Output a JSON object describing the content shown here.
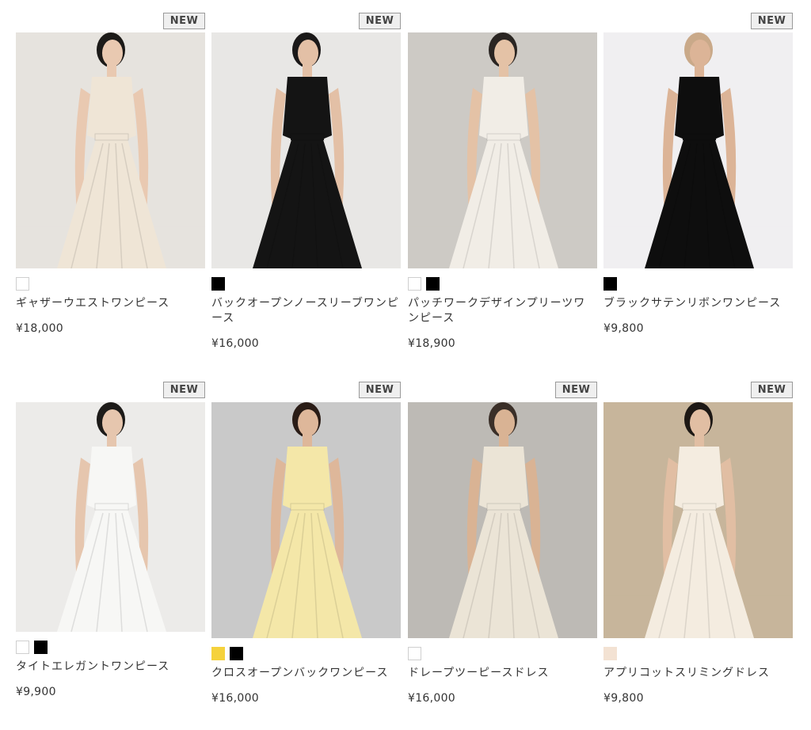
{
  "badge_label": "NEW",
  "products": [
    {
      "name": "ギャザーウエストワンピース",
      "price": "¥18,000",
      "new": true,
      "swatches": [
        "#ffffff"
      ],
      "icon": "pleated-dress-photo",
      "colors": {
        "bg": "#e6e3de",
        "garment": "#efe5d6",
        "skin": "#e9c9b1",
        "hair": "#1c1a18"
      }
    },
    {
      "name": "バックオープンノースリーブワンピース",
      "price": "¥16,000",
      "new": true,
      "swatches": [
        "#000000"
      ],
      "icon": "black-maxi-dress-photo",
      "colors": {
        "bg": "#e8e7e5",
        "garment": "#141414",
        "skin": "#e3c0a6",
        "hair": "#1a1818"
      }
    },
    {
      "name": "パッチワークデザインプリーツワンピース",
      "price": "¥18,900",
      "new": false,
      "swatches": [
        "#ffffff",
        "#000000"
      ],
      "icon": "ivory-patchwork-dress-photo",
      "colors": {
        "bg": "#cdcac5",
        "garment": "#f1ede6",
        "skin": "#e4c2a6",
        "hair": "#2a2522"
      }
    },
    {
      "name": "ブラックサテンリボンワンピース",
      "price": "¥9,800",
      "new": true,
      "swatches": [
        "#000000"
      ],
      "icon": "black-satin-dress-photo",
      "colors": {
        "bg": "#f0eff1",
        "garment": "#0e0e0e",
        "skin": "#dcb497",
        "hair": "#c9a989"
      }
    },
    {
      "name": "タイトエレガントワンピース",
      "price": "¥9,900",
      "new": true,
      "swatches": [
        "#ffffff",
        "#000000"
      ],
      "icon": "white-sleeveless-dress-photo",
      "colors": {
        "bg": "#ecebe9",
        "garment": "#f7f7f5",
        "skin": "#e6c6ae",
        "hair": "#1d1b19"
      }
    },
    {
      "name": "クロスオープンバックワンピース",
      "price": "¥16,000",
      "new": true,
      "swatches": [
        "#f5d23c",
        "#000000"
      ],
      "icon": "yellow-open-back-dress-photo",
      "colors": {
        "bg": "#c9c9c9",
        "garment": "#f4e7a8",
        "skin": "#deb79a",
        "hair": "#2a1c16"
      }
    },
    {
      "name": "ドレープツーピースドレス",
      "price": "¥16,000",
      "new": true,
      "swatches": [
        "#ffffff"
      ],
      "icon": "drape-two-piece-dress-photo",
      "colors": {
        "bg": "#bdbab5",
        "garment": "#ebe4d6",
        "skin": "#d9b394",
        "hair": "#3a2f28"
      }
    },
    {
      "name": "アプリコットスリミングドレス",
      "price": "¥9,800",
      "new": true,
      "swatches": [
        "#f3e2d3"
      ],
      "icon": "apricot-long-sleeve-dress-photo",
      "colors": {
        "bg": "#c7b59b",
        "garment": "#f4ece0",
        "skin": "#e1bea3",
        "hair": "#1d1815"
      }
    }
  ]
}
